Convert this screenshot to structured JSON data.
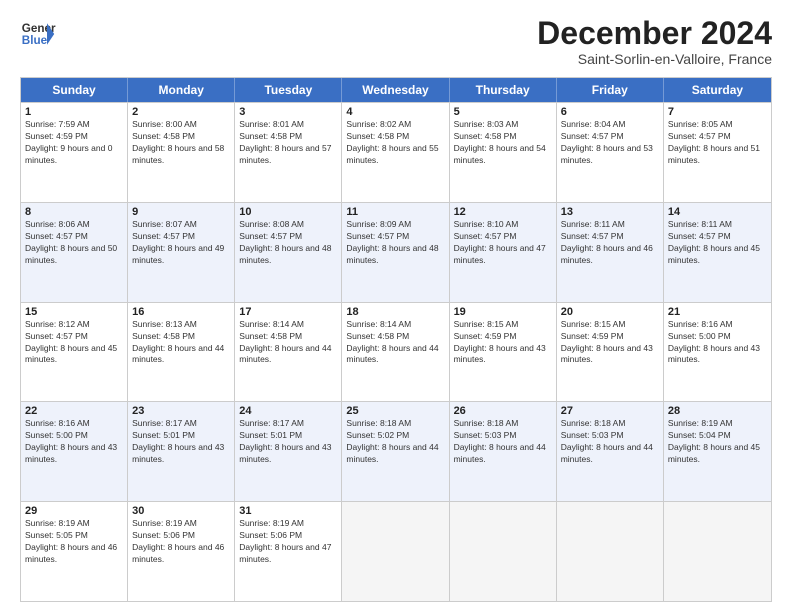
{
  "header": {
    "logo_line1": "General",
    "logo_line2": "Blue",
    "title": "December 2024",
    "subtitle": "Saint-Sorlin-en-Valloire, France"
  },
  "days_of_week": [
    "Sunday",
    "Monday",
    "Tuesday",
    "Wednesday",
    "Thursday",
    "Friday",
    "Saturday"
  ],
  "weeks": [
    [
      {
        "num": "1",
        "sunrise": "Sunrise: 7:59 AM",
        "sunset": "Sunset: 4:59 PM",
        "daylight": "Daylight: 9 hours and 0 minutes."
      },
      {
        "num": "2",
        "sunrise": "Sunrise: 8:00 AM",
        "sunset": "Sunset: 4:58 PM",
        "daylight": "Daylight: 8 hours and 58 minutes."
      },
      {
        "num": "3",
        "sunrise": "Sunrise: 8:01 AM",
        "sunset": "Sunset: 4:58 PM",
        "daylight": "Daylight: 8 hours and 57 minutes."
      },
      {
        "num": "4",
        "sunrise": "Sunrise: 8:02 AM",
        "sunset": "Sunset: 4:58 PM",
        "daylight": "Daylight: 8 hours and 55 minutes."
      },
      {
        "num": "5",
        "sunrise": "Sunrise: 8:03 AM",
        "sunset": "Sunset: 4:58 PM",
        "daylight": "Daylight: 8 hours and 54 minutes."
      },
      {
        "num": "6",
        "sunrise": "Sunrise: 8:04 AM",
        "sunset": "Sunset: 4:57 PM",
        "daylight": "Daylight: 8 hours and 53 minutes."
      },
      {
        "num": "7",
        "sunrise": "Sunrise: 8:05 AM",
        "sunset": "Sunset: 4:57 PM",
        "daylight": "Daylight: 8 hours and 51 minutes."
      }
    ],
    [
      {
        "num": "8",
        "sunrise": "Sunrise: 8:06 AM",
        "sunset": "Sunset: 4:57 PM",
        "daylight": "Daylight: 8 hours and 50 minutes."
      },
      {
        "num": "9",
        "sunrise": "Sunrise: 8:07 AM",
        "sunset": "Sunset: 4:57 PM",
        "daylight": "Daylight: 8 hours and 49 minutes."
      },
      {
        "num": "10",
        "sunrise": "Sunrise: 8:08 AM",
        "sunset": "Sunset: 4:57 PM",
        "daylight": "Daylight: 8 hours and 48 minutes."
      },
      {
        "num": "11",
        "sunrise": "Sunrise: 8:09 AM",
        "sunset": "Sunset: 4:57 PM",
        "daylight": "Daylight: 8 hours and 48 minutes."
      },
      {
        "num": "12",
        "sunrise": "Sunrise: 8:10 AM",
        "sunset": "Sunset: 4:57 PM",
        "daylight": "Daylight: 8 hours and 47 minutes."
      },
      {
        "num": "13",
        "sunrise": "Sunrise: 8:11 AM",
        "sunset": "Sunset: 4:57 PM",
        "daylight": "Daylight: 8 hours and 46 minutes."
      },
      {
        "num": "14",
        "sunrise": "Sunrise: 8:11 AM",
        "sunset": "Sunset: 4:57 PM",
        "daylight": "Daylight: 8 hours and 45 minutes."
      }
    ],
    [
      {
        "num": "15",
        "sunrise": "Sunrise: 8:12 AM",
        "sunset": "Sunset: 4:57 PM",
        "daylight": "Daylight: 8 hours and 45 minutes."
      },
      {
        "num": "16",
        "sunrise": "Sunrise: 8:13 AM",
        "sunset": "Sunset: 4:58 PM",
        "daylight": "Daylight: 8 hours and 44 minutes."
      },
      {
        "num": "17",
        "sunrise": "Sunrise: 8:14 AM",
        "sunset": "Sunset: 4:58 PM",
        "daylight": "Daylight: 8 hours and 44 minutes."
      },
      {
        "num": "18",
        "sunrise": "Sunrise: 8:14 AM",
        "sunset": "Sunset: 4:58 PM",
        "daylight": "Daylight: 8 hours and 44 minutes."
      },
      {
        "num": "19",
        "sunrise": "Sunrise: 8:15 AM",
        "sunset": "Sunset: 4:59 PM",
        "daylight": "Daylight: 8 hours and 43 minutes."
      },
      {
        "num": "20",
        "sunrise": "Sunrise: 8:15 AM",
        "sunset": "Sunset: 4:59 PM",
        "daylight": "Daylight: 8 hours and 43 minutes."
      },
      {
        "num": "21",
        "sunrise": "Sunrise: 8:16 AM",
        "sunset": "Sunset: 5:00 PM",
        "daylight": "Daylight: 8 hours and 43 minutes."
      }
    ],
    [
      {
        "num": "22",
        "sunrise": "Sunrise: 8:16 AM",
        "sunset": "Sunset: 5:00 PM",
        "daylight": "Daylight: 8 hours and 43 minutes."
      },
      {
        "num": "23",
        "sunrise": "Sunrise: 8:17 AM",
        "sunset": "Sunset: 5:01 PM",
        "daylight": "Daylight: 8 hours and 43 minutes."
      },
      {
        "num": "24",
        "sunrise": "Sunrise: 8:17 AM",
        "sunset": "Sunset: 5:01 PM",
        "daylight": "Daylight: 8 hours and 43 minutes."
      },
      {
        "num": "25",
        "sunrise": "Sunrise: 8:18 AM",
        "sunset": "Sunset: 5:02 PM",
        "daylight": "Daylight: 8 hours and 44 minutes."
      },
      {
        "num": "26",
        "sunrise": "Sunrise: 8:18 AM",
        "sunset": "Sunset: 5:03 PM",
        "daylight": "Daylight: 8 hours and 44 minutes."
      },
      {
        "num": "27",
        "sunrise": "Sunrise: 8:18 AM",
        "sunset": "Sunset: 5:03 PM",
        "daylight": "Daylight: 8 hours and 44 minutes."
      },
      {
        "num": "28",
        "sunrise": "Sunrise: 8:19 AM",
        "sunset": "Sunset: 5:04 PM",
        "daylight": "Daylight: 8 hours and 45 minutes."
      }
    ],
    [
      {
        "num": "29",
        "sunrise": "Sunrise: 8:19 AM",
        "sunset": "Sunset: 5:05 PM",
        "daylight": "Daylight: 8 hours and 46 minutes."
      },
      {
        "num": "30",
        "sunrise": "Sunrise: 8:19 AM",
        "sunset": "Sunset: 5:06 PM",
        "daylight": "Daylight: 8 hours and 46 minutes."
      },
      {
        "num": "31",
        "sunrise": "Sunrise: 8:19 AM",
        "sunset": "Sunset: 5:06 PM",
        "daylight": "Daylight: 8 hours and 47 minutes."
      },
      null,
      null,
      null,
      null
    ]
  ]
}
